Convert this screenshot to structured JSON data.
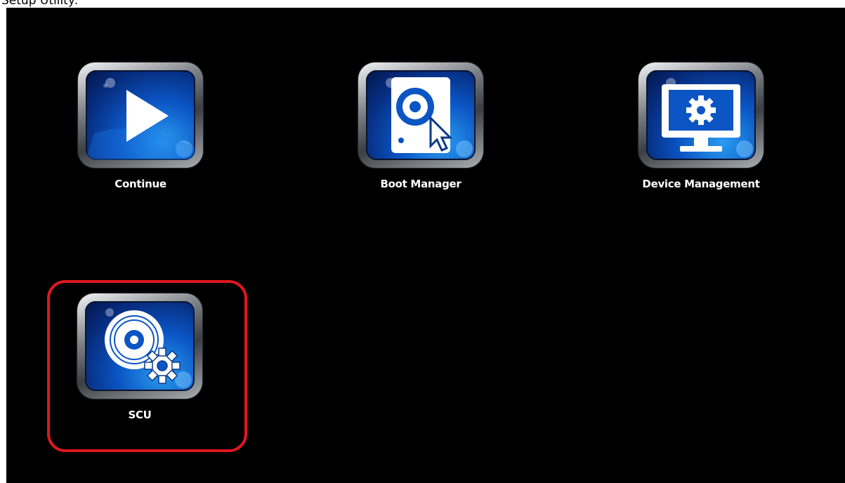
{
  "caption": "Setup Utility:",
  "menu": {
    "items": [
      {
        "id": "continue",
        "label": "Continue",
        "icon": "play-icon"
      },
      {
        "id": "boot-manager",
        "label": "Boot Manager",
        "icon": "boot-drive-cursor-icon"
      },
      {
        "id": "device-management",
        "label": "Device Management",
        "icon": "monitor-gear-icon"
      },
      {
        "id": "scu",
        "label": "SCU",
        "icon": "disc-gear-icon",
        "highlighted": true
      }
    ]
  },
  "colors": {
    "background": "#000000",
    "highlight": "#e0161e",
    "icon_blue": "#0b55c4",
    "label": "#ffffff"
  }
}
